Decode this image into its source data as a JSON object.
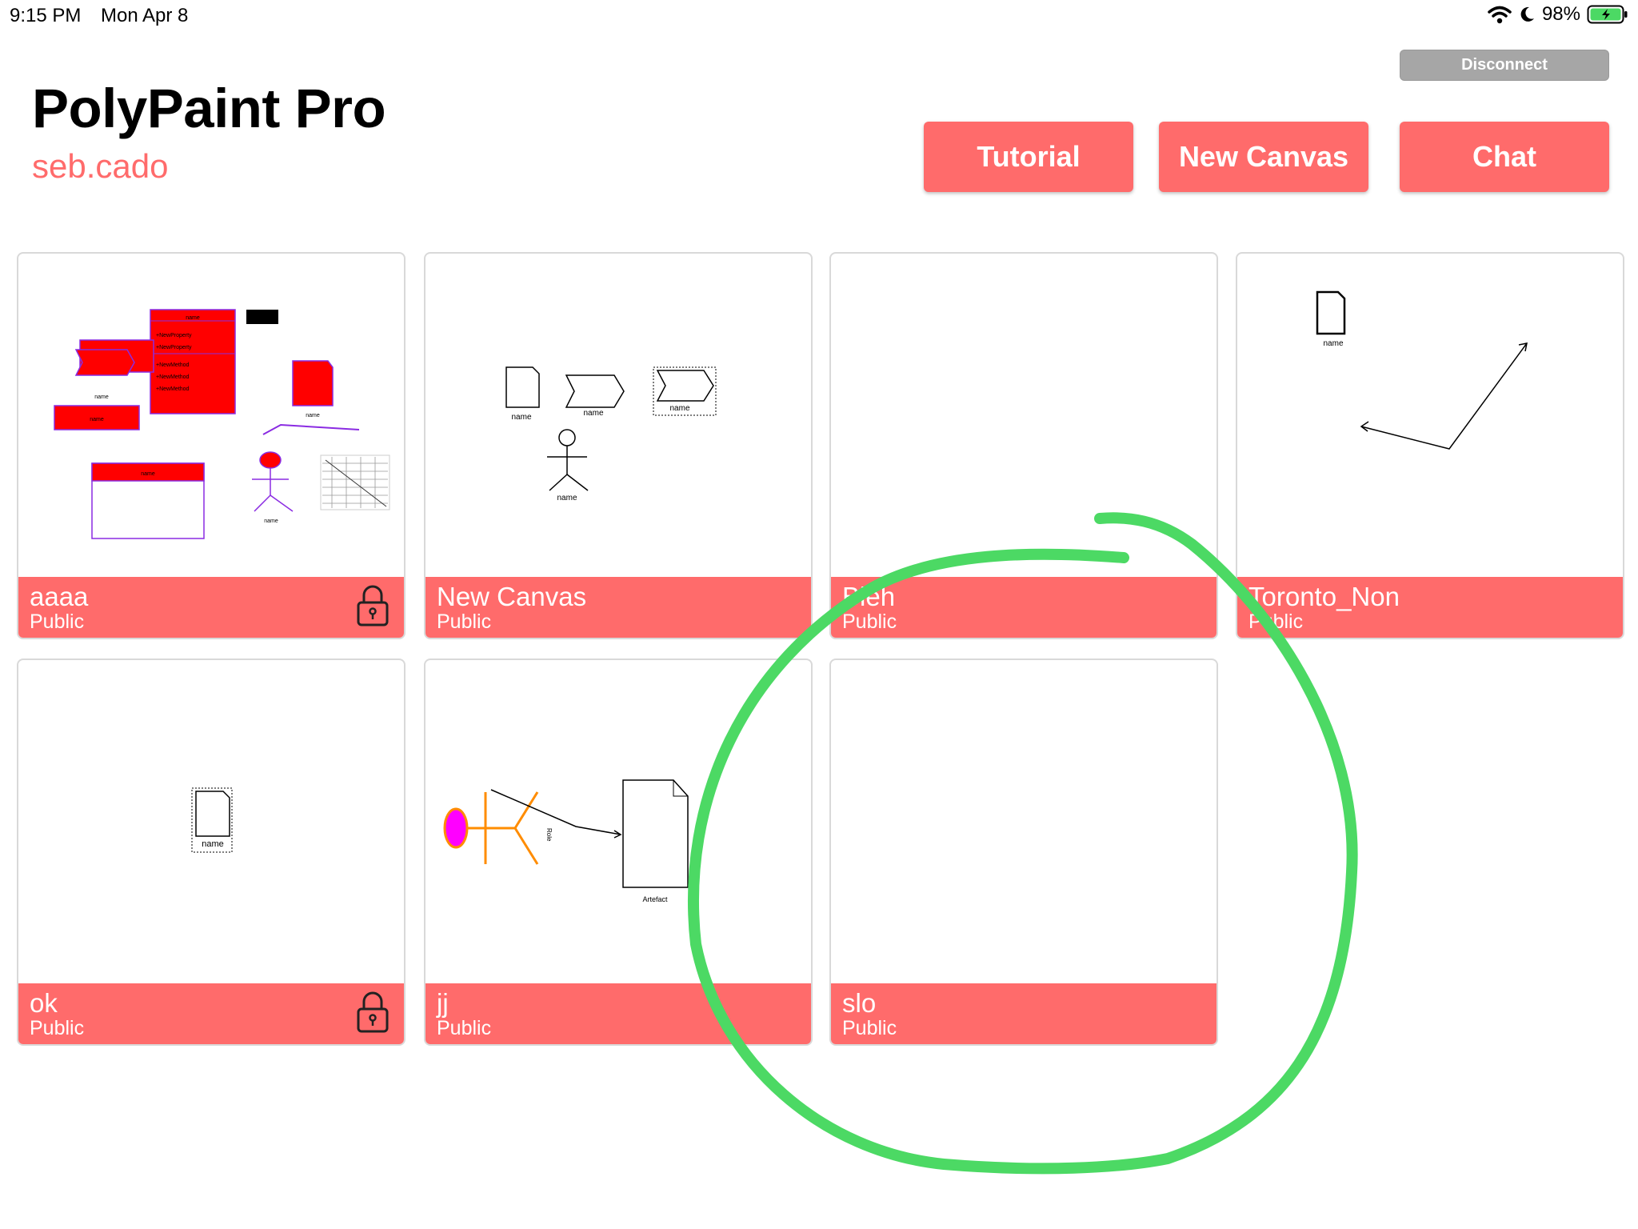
{
  "status_bar": {
    "time": "9:15 PM",
    "date": "Mon Apr 8",
    "battery": "98%",
    "icons": [
      "wifi-icon",
      "moon-icon",
      "battery-icon"
    ]
  },
  "header": {
    "app_title": "PolyPaint Pro",
    "username": "seb.cado",
    "disconnect_label": "Disconnect",
    "tutorial_label": "Tutorial",
    "new_canvas_label": "New Canvas",
    "chat_label": "Chat"
  },
  "colors": {
    "accent": "#ff6b6b",
    "disconnect_gray": "#a6a6a6",
    "annotation_green": "#4cd964"
  },
  "preview_labels": {
    "name": "name",
    "role": "Role",
    "artefact": "Artefact",
    "new_property": "+NewProperty",
    "new_method": "+NewMethod"
  },
  "canvases": [
    {
      "name": "aaaa",
      "visibility": "Public",
      "locked": true
    },
    {
      "name": "New Canvas",
      "visibility": "Public",
      "locked": false
    },
    {
      "name": "Bleh",
      "visibility": "Public",
      "locked": false
    },
    {
      "name": "Toronto_Non",
      "visibility": "Public",
      "locked": false
    },
    {
      "name": "ok",
      "visibility": "Public",
      "locked": true
    },
    {
      "name": "jj",
      "visibility": "Public",
      "locked": false
    },
    {
      "name": "slo",
      "visibility": "Public",
      "locked": false
    }
  ]
}
